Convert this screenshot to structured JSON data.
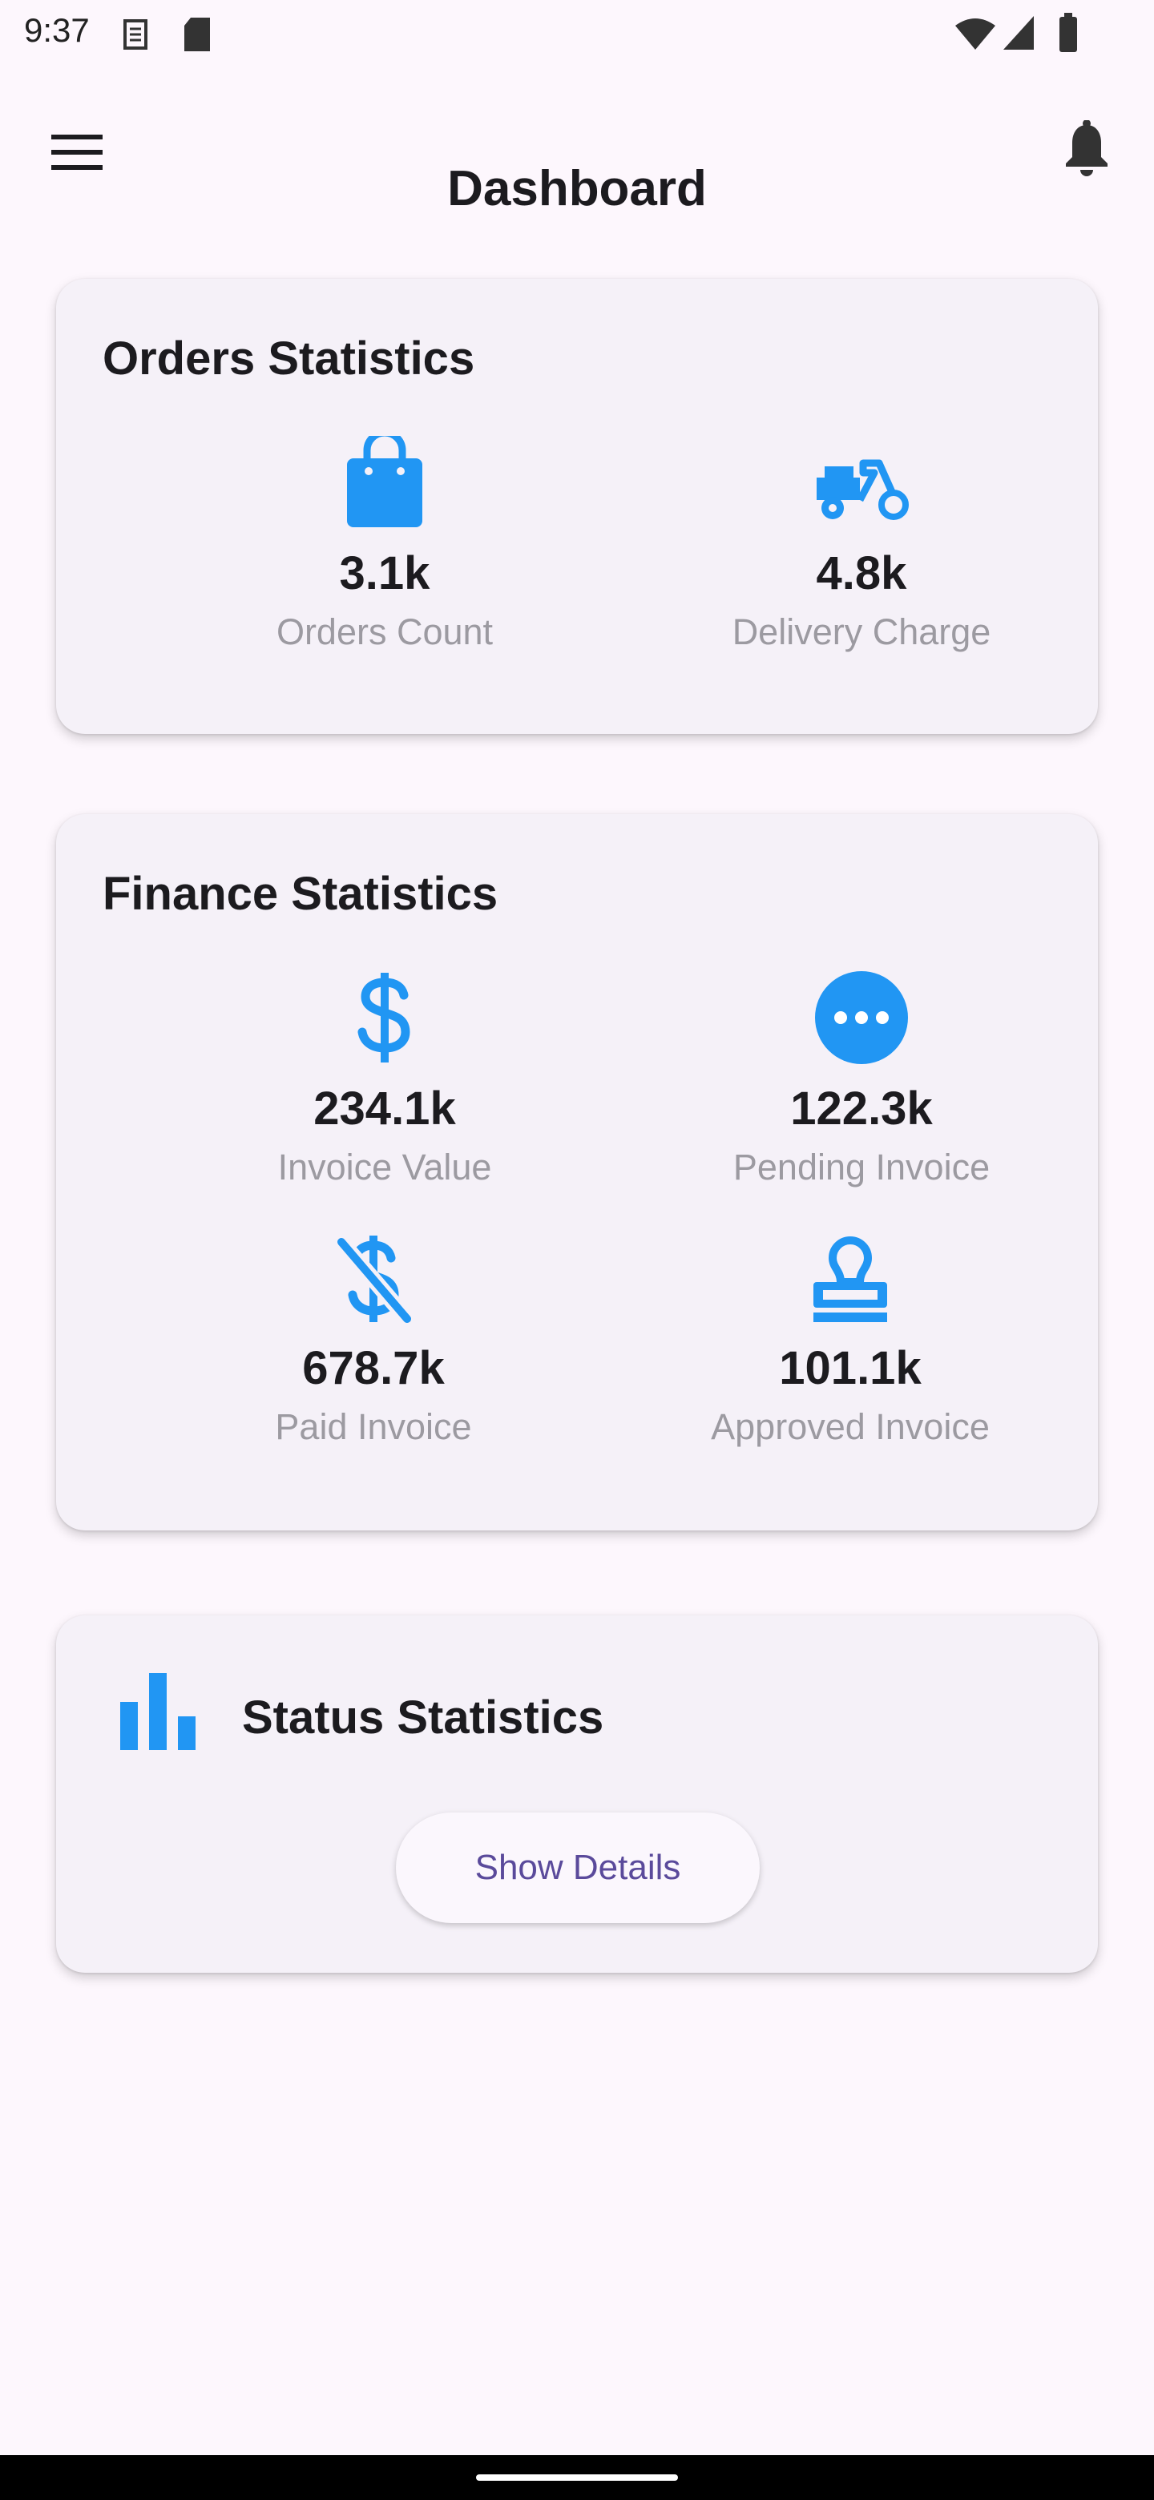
{
  "status_bar": {
    "time": "9:37",
    "icons": [
      "sim-icon",
      "sd-card-icon",
      "wifi-icon",
      "signal-icon",
      "battery-icon"
    ]
  },
  "app_bar": {
    "title": "Dashboard",
    "menu_icon": "menu-icon",
    "notification_icon": "bell-icon"
  },
  "accent_color": "#2196f3",
  "orders": {
    "title": "Orders Statistics",
    "items": [
      {
        "icon": "shopping-bag-icon",
        "value": "3.1k",
        "label": "Orders Count"
      },
      {
        "icon": "scooter-icon",
        "value": "4.8k",
        "label": "Delivery Charge"
      }
    ]
  },
  "finance": {
    "title": "Finance Statistics",
    "items": [
      {
        "icon": "dollar-icon",
        "value": "234.1k",
        "label": "Invoice Value"
      },
      {
        "icon": "pending-icon",
        "value": "122.3k",
        "label": "Pending Invoice"
      },
      {
        "icon": "money-off-icon",
        "value": "678.7k",
        "label": "Paid Invoice"
      },
      {
        "icon": "stamp-icon",
        "value": "101.1k",
        "label": "Approved Invoice"
      }
    ]
  },
  "status": {
    "title": "Status Statistics",
    "icon": "bar-chart-icon",
    "button_label": "Show Details"
  }
}
